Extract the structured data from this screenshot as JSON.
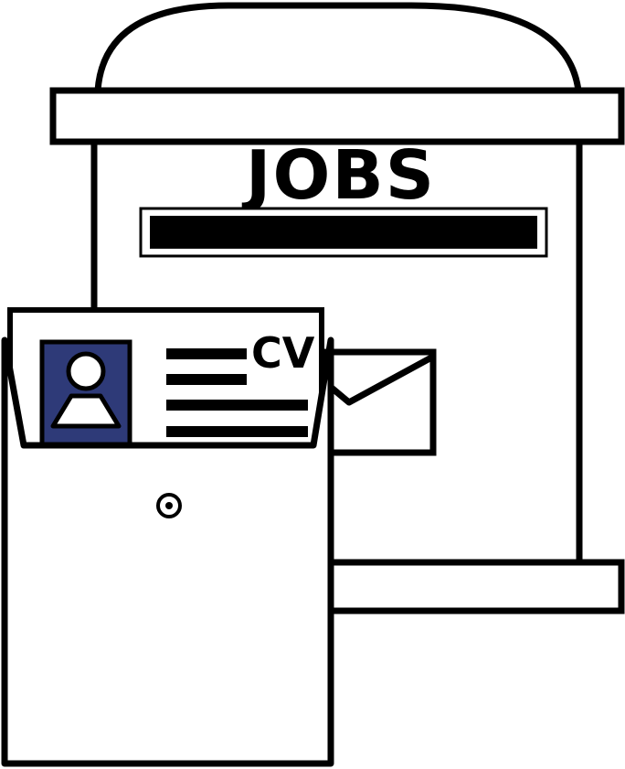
{
  "illustration": {
    "mailbox_sign": "JOBS",
    "cv_label": "CV"
  },
  "colors": {
    "outline": "#000000",
    "fill": "#ffffff",
    "photo_frame": "#2e3a78"
  },
  "icons": {
    "mailbox": "mailbox-icon",
    "envelope": "envelope-icon",
    "folder": "folder-icon",
    "resume": "resume-icon",
    "person": "person-silhouette-icon"
  }
}
